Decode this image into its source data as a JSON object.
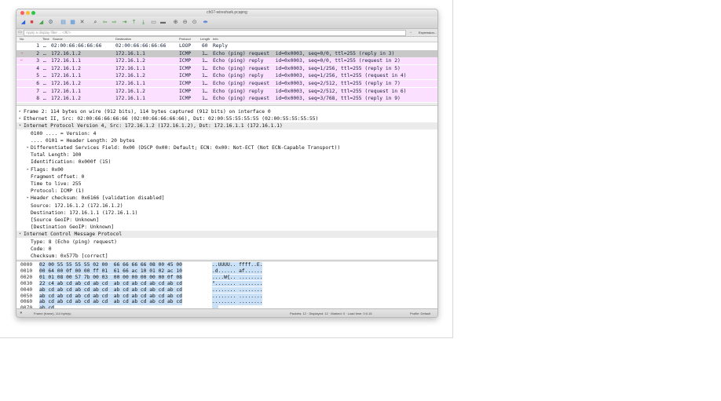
{
  "window": {
    "title": "ch07-wireshark.pcapng"
  },
  "filter": {
    "placeholder": "Apply a display filter ... <⌘/>",
    "arrow": "→",
    "expression": "Expression..."
  },
  "columns": {
    "no": "No.",
    "time": "Time",
    "source": "Source",
    "destination": "Destination",
    "protocol": "Protocol",
    "length": "Length",
    "info": "Info"
  },
  "packets": [
    {
      "no": "1",
      "time": "…",
      "source": "02:00:66:66:66:66",
      "destination": "02:00:66:66:66:66",
      "protocol": "LOOP",
      "length": "60",
      "info": "Reply",
      "style": "plain"
    },
    {
      "no": "2",
      "time": "…",
      "source": "172.16.1.2",
      "destination": "172.16.1.1",
      "protocol": "ICMP",
      "length": "1…",
      "info": "Echo (ping) request  id=0x0003, seq=0/0, ttl=255 (reply in 3)",
      "style": "selected"
    },
    {
      "no": "3",
      "time": "…",
      "source": "172.16.1.1",
      "destination": "172.16.1.2",
      "protocol": "ICMP",
      "length": "1…",
      "info": "Echo (ping) reply    id=0x0003, seq=0/0, ttl=255 (request in 2)",
      "style": "icmp"
    },
    {
      "no": "4",
      "time": "…",
      "source": "172.16.1.2",
      "destination": "172.16.1.1",
      "protocol": "ICMP",
      "length": "1…",
      "info": "Echo (ping) request  id=0x0003, seq=1/256, ttl=255 (reply in 5)",
      "style": "icmp"
    },
    {
      "no": "5",
      "time": "…",
      "source": "172.16.1.1",
      "destination": "172.16.1.2",
      "protocol": "ICMP",
      "length": "1…",
      "info": "Echo (ping) reply    id=0x0003, seq=1/256, ttl=255 (request in 4)",
      "style": "icmp"
    },
    {
      "no": "6",
      "time": "…",
      "source": "172.16.1.2",
      "destination": "172.16.1.1",
      "protocol": "ICMP",
      "length": "1…",
      "info": "Echo (ping) request  id=0x0003, seq=2/512, ttl=255 (reply in 7)",
      "style": "icmp"
    },
    {
      "no": "7",
      "time": "…",
      "source": "172.16.1.1",
      "destination": "172.16.1.2",
      "protocol": "ICMP",
      "length": "1…",
      "info": "Echo (ping) reply    id=0x0003, seq=2/512, ttl=255 (request in 6)",
      "style": "icmp"
    },
    {
      "no": "8",
      "time": "…",
      "source": "172.16.1.2",
      "destination": "172.16.1.1",
      "protocol": "ICMP",
      "length": "1…",
      "info": "Echo (ping) request  id=0x0003, seq=3/768, ttl=255 (reply in 9)",
      "style": "icmp"
    }
  ],
  "details": [
    {
      "text": "Frame 2: 114 bytes on wire (912 bits), 114 bytes captured (912 bits) on interface 0",
      "indent": 0,
      "toggle": "▸",
      "section": false
    },
    {
      "text": "Ethernet II, Src: 02:00:66:66:66:66 (02:00:66:66:66:66), Dst: 02:00:55:55:55:55 (02:00:55:55:55:55)",
      "indent": 0,
      "toggle": "▸",
      "section": false
    },
    {
      "text": "Internet Protocol Version 4, Src: 172.16.1.2 (172.16.1.2), Dst: 172.16.1.1 (172.16.1.1)",
      "indent": 0,
      "toggle": "▾",
      "section": true
    },
    {
      "text": "0100 .... = Version: 4",
      "indent": 2,
      "toggle": "",
      "section": false
    },
    {
      "text": ".... 0101 = Header Length: 20 bytes",
      "indent": 2,
      "toggle": "",
      "section": false
    },
    {
      "text": "Differentiated Services Field: 0x00 (DSCP 0x00: Default; ECN: 0x00: Not-ECT (Not ECN-Capable Transport))",
      "indent": 1,
      "toggle": "▸",
      "section": false
    },
    {
      "text": "Total Length: 100",
      "indent": 2,
      "toggle": "",
      "section": false
    },
    {
      "text": "Identification: 0x000f (15)",
      "indent": 2,
      "toggle": "",
      "section": false
    },
    {
      "text": "Flags: 0x00",
      "indent": 1,
      "toggle": "▸",
      "section": false
    },
    {
      "text": "Fragment offset: 0",
      "indent": 2,
      "toggle": "",
      "section": false
    },
    {
      "text": "Time to live: 255",
      "indent": 2,
      "toggle": "",
      "section": false
    },
    {
      "text": "Protocol: ICMP (1)",
      "indent": 2,
      "toggle": "",
      "section": false
    },
    {
      "text": "Header checksum: 0x6166 [validation disabled]",
      "indent": 1,
      "toggle": "▸",
      "section": false
    },
    {
      "text": "Source: 172.16.1.2 (172.16.1.2)",
      "indent": 2,
      "toggle": "",
      "section": false
    },
    {
      "text": "Destination: 172.16.1.1 (172.16.1.1)",
      "indent": 2,
      "toggle": "",
      "section": false
    },
    {
      "text": "[Source GeoIP: Unknown]",
      "indent": 2,
      "toggle": "",
      "section": false
    },
    {
      "text": "[Destination GeoIP: Unknown]",
      "indent": 2,
      "toggle": "",
      "section": false
    },
    {
      "text": "Internet Control Message Protocol",
      "indent": 0,
      "toggle": "▾",
      "section": true
    },
    {
      "text": "Type: 8 (Echo (ping) request)",
      "indent": 2,
      "toggle": "",
      "section": false
    },
    {
      "text": "Code: 0",
      "indent": 2,
      "toggle": "",
      "section": false
    },
    {
      "text": "Checksum: 0x577b [correct]",
      "indent": 2,
      "toggle": "",
      "section": false
    }
  ],
  "bytes": [
    {
      "offset": "0000",
      "hex": "02 00 55 55 55 55 02 00  66 66 66 66 08 00 45 00",
      "ascii": "..UUUU.. ffff..E."
    },
    {
      "offset": "0010",
      "hex": "00 64 00 0f 00 00 ff 01  61 66 ac 10 01 02 ac 10",
      "ascii": ".d...... af......"
    },
    {
      "offset": "0020",
      "hex": "01 01 08 00 57 7b 00 03  00 00 00 00 00 00 0f 08",
      "ascii": "....W{.. ........"
    },
    {
      "offset": "0030",
      "hex": "22 c4 ab cd ab cd ab cd  ab cd ab cd ab cd ab cd",
      "ascii": "\"....... ........"
    },
    {
      "offset": "0040",
      "hex": "ab cd ab cd ab cd ab cd  ab cd ab cd ab cd ab cd",
      "ascii": "........ ........"
    },
    {
      "offset": "0050",
      "hex": "ab cd ab cd ab cd ab cd  ab cd ab cd ab cd ab cd",
      "ascii": "........ ........"
    },
    {
      "offset": "0060",
      "hex": "ab cd ab cd ab cd ab cd  ab cd ab cd ab cd ab cd",
      "ascii": "........ ........"
    },
    {
      "offset": "0070",
      "hex": "ab cd",
      "ascii": ".."
    }
  ],
  "status": {
    "frame": "Frame (frame), 114 byte(s)",
    "counts": "Packets: 12 · Displayed: 12 · Marked: 0 · Load time: 0:0.15",
    "profile": "Profile: Default"
  },
  "toolbar": {
    "icons": [
      {
        "name": "start-capture-icon",
        "glyph": "◢",
        "color": "#2d5fd8"
      },
      {
        "name": "stop-capture-icon",
        "glyph": "■",
        "color": "#d83b3b"
      },
      {
        "name": "restart-capture-icon",
        "glyph": "◢",
        "color": "#4aa34a"
      },
      {
        "name": "capture-options-icon",
        "glyph": "⚙",
        "color": "#5b6b86"
      },
      {
        "name": "open-file-icon",
        "glyph": "▤",
        "color": "#4a8ad8"
      },
      {
        "name": "save-file-icon",
        "glyph": "▦",
        "color": "#4a8ad8"
      },
      {
        "name": "close-file-icon",
        "glyph": "✕",
        "color": "#555555"
      },
      {
        "name": "find-packet-icon",
        "glyph": "⌕",
        "color": "#444444"
      },
      {
        "name": "go-back-icon",
        "glyph": "⇦",
        "color": "#3d9a3d"
      },
      {
        "name": "go-forward-icon",
        "glyph": "⇨",
        "color": "#3d9a3d"
      },
      {
        "name": "go-to-packet-icon",
        "glyph": "⇥",
        "color": "#3d9a3d"
      },
      {
        "name": "go-first-icon",
        "glyph": "⤒",
        "color": "#3d9a3d"
      },
      {
        "name": "go-last-icon",
        "glyph": "⤓",
        "color": "#3d9a3d"
      },
      {
        "name": "auto-scroll-icon",
        "glyph": "▭",
        "color": "#666666"
      },
      {
        "name": "colorize-icon",
        "glyph": "▬",
        "color": "#666666"
      },
      {
        "name": "zoom-in-icon",
        "glyph": "⊕",
        "color": "#555555"
      },
      {
        "name": "zoom-out-icon",
        "glyph": "⊖",
        "color": "#555555"
      },
      {
        "name": "zoom-normal-icon",
        "glyph": "⊙",
        "color": "#555555"
      },
      {
        "name": "resize-columns-icon",
        "glyph": "⇹",
        "color": "#2d5fd8"
      }
    ]
  },
  "colors": {
    "selected": "#c8c8c8",
    "icmp": "#fce0ff",
    "plain": "#ffffff"
  }
}
